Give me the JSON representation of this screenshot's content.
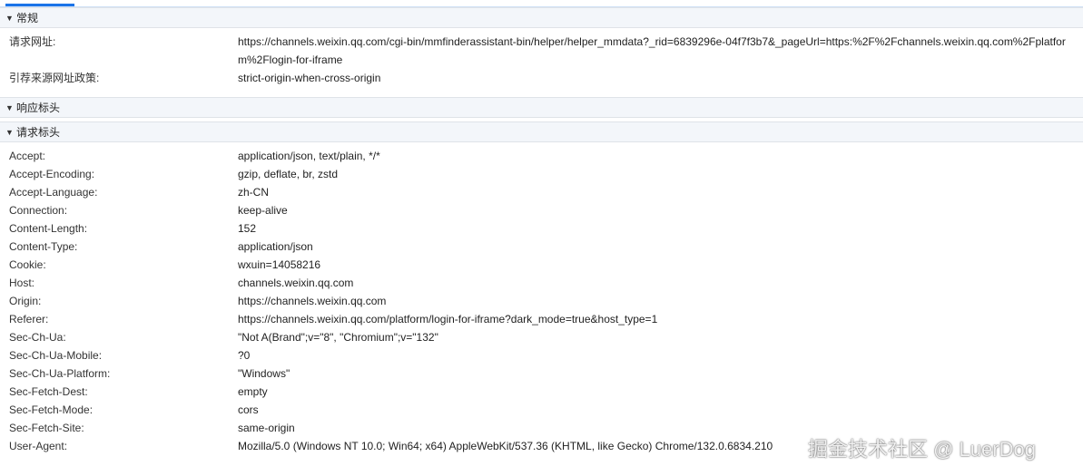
{
  "sections": {
    "general": {
      "title": "常规",
      "rows": [
        {
          "key": "请求网址:",
          "value": "https://channels.weixin.qq.com/cgi-bin/mmfinderassistant-bin/helper/helper_mmdata?_rid=6839296e-04f7f3b7&_pageUrl=https:%2F%2Fchannels.weixin.qq.com%2Fplatform%2Flogin-for-iframe"
        },
        {
          "key": "引荐来源网址政策:",
          "value": "strict-origin-when-cross-origin"
        }
      ]
    },
    "response_headers": {
      "title": "响应标头"
    },
    "request_headers": {
      "title": "请求标头",
      "rows": [
        {
          "key": "Accept:",
          "value": "application/json, text/plain, */*"
        },
        {
          "key": "Accept-Encoding:",
          "value": "gzip, deflate, br, zstd"
        },
        {
          "key": "Accept-Language:",
          "value": "zh-CN"
        },
        {
          "key": "Connection:",
          "value": "keep-alive"
        },
        {
          "key": "Content-Length:",
          "value": "152"
        },
        {
          "key": "Content-Type:",
          "value": "application/json"
        },
        {
          "key": "Cookie:",
          "value": "wxuin=14058216"
        },
        {
          "key": "Host:",
          "value": "channels.weixin.qq.com"
        },
        {
          "key": "Origin:",
          "value": "https://channels.weixin.qq.com"
        },
        {
          "key": "Referer:",
          "value": "https://channels.weixin.qq.com/platform/login-for-iframe?dark_mode=true&host_type=1"
        },
        {
          "key": "Sec-Ch-Ua:",
          "value": "\"Not A(Brand\";v=\"8\", \"Chromium\";v=\"132\""
        },
        {
          "key": "Sec-Ch-Ua-Mobile:",
          "value": "?0"
        },
        {
          "key": "Sec-Ch-Ua-Platform:",
          "value": "\"Windows\""
        },
        {
          "key": "Sec-Fetch-Dest:",
          "value": "empty"
        },
        {
          "key": "Sec-Fetch-Mode:",
          "value": "cors"
        },
        {
          "key": "Sec-Fetch-Site:",
          "value": "same-origin"
        },
        {
          "key": "User-Agent:",
          "value": "Mozilla/5.0 (Windows NT 10.0; Win64; x64) AppleWebKit/537.36 (KHTML, like Gecko) Chrome/132.0.6834.210"
        }
      ]
    }
  },
  "caret": "▼",
  "watermark": "掘金技术社区 @ LuerDog",
  "colors": {
    "accent": "#1a73e8",
    "section_bg": "#f3f6fa"
  }
}
